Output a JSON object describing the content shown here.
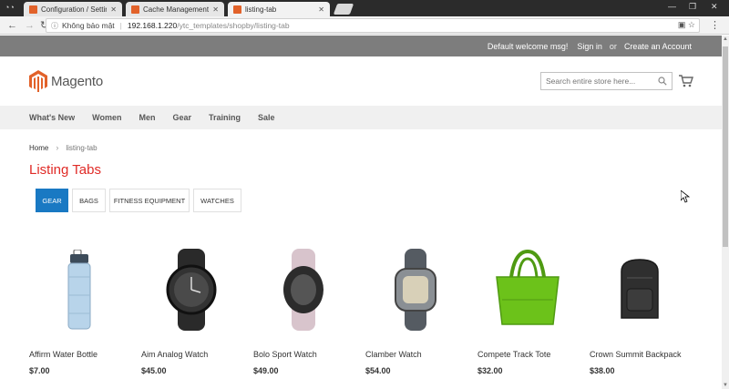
{
  "browser": {
    "tabs": [
      {
        "title": "Configuration / Settings"
      },
      {
        "title": "Cache Management / To"
      },
      {
        "title": "listing-tab"
      }
    ],
    "address": {
      "security_label": "Không bảo mật",
      "host": "192.168.1.220",
      "path": "/ytc_templates/shopby/listing-tab"
    }
  },
  "header": {
    "welcome": "Default welcome msg!",
    "sign_in": "Sign in",
    "or": "or",
    "create_account": "Create an Account",
    "logo_text": "Magento",
    "search_placeholder": "Search entire store here..."
  },
  "nav": {
    "items": [
      "What's New",
      "Women",
      "Men",
      "Gear",
      "Training",
      "Sale"
    ]
  },
  "breadcrumbs": {
    "home": "Home",
    "current": "listing-tab"
  },
  "page_title": "Listing Tabs",
  "listing_tabs": [
    {
      "label": "GEAR",
      "active": true
    },
    {
      "label": "BAGS",
      "active": false
    },
    {
      "label": "FITNESS EQUIPMENT",
      "active": false
    },
    {
      "label": "WATCHES",
      "active": false
    }
  ],
  "products": [
    {
      "name": "Affirm Water Bottle",
      "price": "$7.00",
      "image": "water-bottle"
    },
    {
      "name": "Aim Analog Watch",
      "price": "$45.00",
      "image": "analog-watch"
    },
    {
      "name": "Bolo Sport Watch",
      "price": "$49.00",
      "image": "sport-watch"
    },
    {
      "name": "Clamber Watch",
      "price": "$54.00",
      "image": "clamber-watch"
    },
    {
      "name": "Compete Track Tote",
      "price": "$32.00",
      "image": "track-tote"
    },
    {
      "name": "Crown Summit Backpack",
      "price": "$38.00",
      "image": "backpack"
    }
  ],
  "colors": {
    "accent_blue": "#1979c3",
    "title_red": "#e02b27",
    "logo_orange": "#e2622a",
    "panel_gray": "#7d7d7d"
  }
}
